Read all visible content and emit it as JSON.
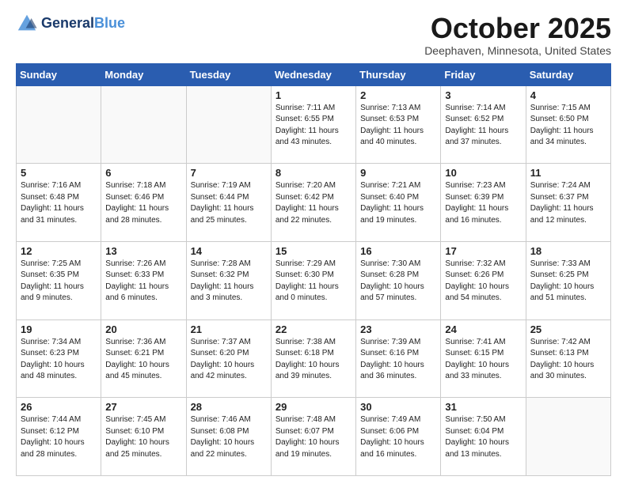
{
  "header": {
    "logo_line1": "General",
    "logo_line2": "Blue",
    "month_title": "October 2025",
    "location": "Deephaven, Minnesota, United States"
  },
  "weekdays": [
    "Sunday",
    "Monday",
    "Tuesday",
    "Wednesday",
    "Thursday",
    "Friday",
    "Saturday"
  ],
  "weeks": [
    [
      {
        "day": "",
        "detail": ""
      },
      {
        "day": "",
        "detail": ""
      },
      {
        "day": "",
        "detail": ""
      },
      {
        "day": "1",
        "detail": "Sunrise: 7:11 AM\nSunset: 6:55 PM\nDaylight: 11 hours\nand 43 minutes."
      },
      {
        "day": "2",
        "detail": "Sunrise: 7:13 AM\nSunset: 6:53 PM\nDaylight: 11 hours\nand 40 minutes."
      },
      {
        "day": "3",
        "detail": "Sunrise: 7:14 AM\nSunset: 6:52 PM\nDaylight: 11 hours\nand 37 minutes."
      },
      {
        "day": "4",
        "detail": "Sunrise: 7:15 AM\nSunset: 6:50 PM\nDaylight: 11 hours\nand 34 minutes."
      }
    ],
    [
      {
        "day": "5",
        "detail": "Sunrise: 7:16 AM\nSunset: 6:48 PM\nDaylight: 11 hours\nand 31 minutes."
      },
      {
        "day": "6",
        "detail": "Sunrise: 7:18 AM\nSunset: 6:46 PM\nDaylight: 11 hours\nand 28 minutes."
      },
      {
        "day": "7",
        "detail": "Sunrise: 7:19 AM\nSunset: 6:44 PM\nDaylight: 11 hours\nand 25 minutes."
      },
      {
        "day": "8",
        "detail": "Sunrise: 7:20 AM\nSunset: 6:42 PM\nDaylight: 11 hours\nand 22 minutes."
      },
      {
        "day": "9",
        "detail": "Sunrise: 7:21 AM\nSunset: 6:40 PM\nDaylight: 11 hours\nand 19 minutes."
      },
      {
        "day": "10",
        "detail": "Sunrise: 7:23 AM\nSunset: 6:39 PM\nDaylight: 11 hours\nand 16 minutes."
      },
      {
        "day": "11",
        "detail": "Sunrise: 7:24 AM\nSunset: 6:37 PM\nDaylight: 11 hours\nand 12 minutes."
      }
    ],
    [
      {
        "day": "12",
        "detail": "Sunrise: 7:25 AM\nSunset: 6:35 PM\nDaylight: 11 hours\nand 9 minutes."
      },
      {
        "day": "13",
        "detail": "Sunrise: 7:26 AM\nSunset: 6:33 PM\nDaylight: 11 hours\nand 6 minutes."
      },
      {
        "day": "14",
        "detail": "Sunrise: 7:28 AM\nSunset: 6:32 PM\nDaylight: 11 hours\nand 3 minutes."
      },
      {
        "day": "15",
        "detail": "Sunrise: 7:29 AM\nSunset: 6:30 PM\nDaylight: 11 hours\nand 0 minutes."
      },
      {
        "day": "16",
        "detail": "Sunrise: 7:30 AM\nSunset: 6:28 PM\nDaylight: 10 hours\nand 57 minutes."
      },
      {
        "day": "17",
        "detail": "Sunrise: 7:32 AM\nSunset: 6:26 PM\nDaylight: 10 hours\nand 54 minutes."
      },
      {
        "day": "18",
        "detail": "Sunrise: 7:33 AM\nSunset: 6:25 PM\nDaylight: 10 hours\nand 51 minutes."
      }
    ],
    [
      {
        "day": "19",
        "detail": "Sunrise: 7:34 AM\nSunset: 6:23 PM\nDaylight: 10 hours\nand 48 minutes."
      },
      {
        "day": "20",
        "detail": "Sunrise: 7:36 AM\nSunset: 6:21 PM\nDaylight: 10 hours\nand 45 minutes."
      },
      {
        "day": "21",
        "detail": "Sunrise: 7:37 AM\nSunset: 6:20 PM\nDaylight: 10 hours\nand 42 minutes."
      },
      {
        "day": "22",
        "detail": "Sunrise: 7:38 AM\nSunset: 6:18 PM\nDaylight: 10 hours\nand 39 minutes."
      },
      {
        "day": "23",
        "detail": "Sunrise: 7:39 AM\nSunset: 6:16 PM\nDaylight: 10 hours\nand 36 minutes."
      },
      {
        "day": "24",
        "detail": "Sunrise: 7:41 AM\nSunset: 6:15 PM\nDaylight: 10 hours\nand 33 minutes."
      },
      {
        "day": "25",
        "detail": "Sunrise: 7:42 AM\nSunset: 6:13 PM\nDaylight: 10 hours\nand 30 minutes."
      }
    ],
    [
      {
        "day": "26",
        "detail": "Sunrise: 7:44 AM\nSunset: 6:12 PM\nDaylight: 10 hours\nand 28 minutes."
      },
      {
        "day": "27",
        "detail": "Sunrise: 7:45 AM\nSunset: 6:10 PM\nDaylight: 10 hours\nand 25 minutes."
      },
      {
        "day": "28",
        "detail": "Sunrise: 7:46 AM\nSunset: 6:08 PM\nDaylight: 10 hours\nand 22 minutes."
      },
      {
        "day": "29",
        "detail": "Sunrise: 7:48 AM\nSunset: 6:07 PM\nDaylight: 10 hours\nand 19 minutes."
      },
      {
        "day": "30",
        "detail": "Sunrise: 7:49 AM\nSunset: 6:06 PM\nDaylight: 10 hours\nand 16 minutes."
      },
      {
        "day": "31",
        "detail": "Sunrise: 7:50 AM\nSunset: 6:04 PM\nDaylight: 10 hours\nand 13 minutes."
      },
      {
        "day": "",
        "detail": ""
      }
    ]
  ]
}
